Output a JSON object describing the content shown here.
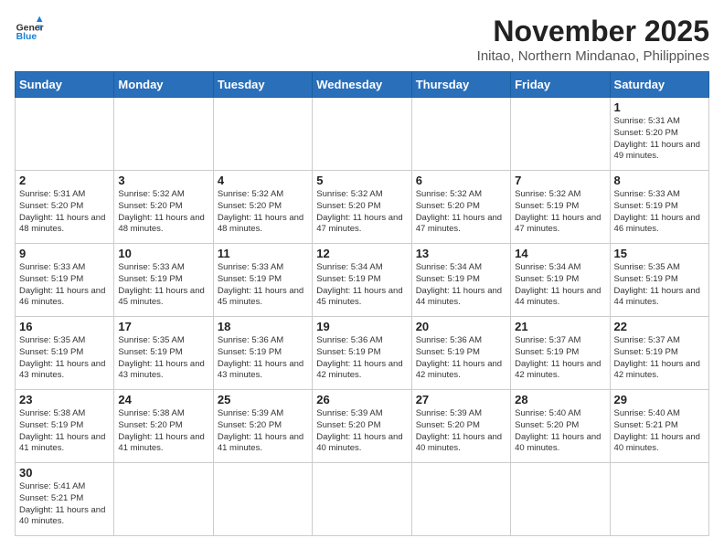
{
  "header": {
    "logo_general": "General",
    "logo_blue": "Blue",
    "month_title": "November 2025",
    "location": "Initao, Northern Mindanao, Philippines"
  },
  "days_of_week": [
    "Sunday",
    "Monday",
    "Tuesday",
    "Wednesday",
    "Thursday",
    "Friday",
    "Saturday"
  ],
  "weeks": [
    [
      {
        "day": "",
        "sunrise": "",
        "sunset": "",
        "daylight": ""
      },
      {
        "day": "",
        "sunrise": "",
        "sunset": "",
        "daylight": ""
      },
      {
        "day": "",
        "sunrise": "",
        "sunset": "",
        "daylight": ""
      },
      {
        "day": "",
        "sunrise": "",
        "sunset": "",
        "daylight": ""
      },
      {
        "day": "",
        "sunrise": "",
        "sunset": "",
        "daylight": ""
      },
      {
        "day": "",
        "sunrise": "",
        "sunset": "",
        "daylight": ""
      },
      {
        "day": "1",
        "sunrise": "Sunrise: 5:31 AM",
        "sunset": "Sunset: 5:20 PM",
        "daylight": "Daylight: 11 hours and 49 minutes."
      }
    ],
    [
      {
        "day": "2",
        "sunrise": "Sunrise: 5:31 AM",
        "sunset": "Sunset: 5:20 PM",
        "daylight": "Daylight: 11 hours and 48 minutes."
      },
      {
        "day": "3",
        "sunrise": "Sunrise: 5:32 AM",
        "sunset": "Sunset: 5:20 PM",
        "daylight": "Daylight: 11 hours and 48 minutes."
      },
      {
        "day": "4",
        "sunrise": "Sunrise: 5:32 AM",
        "sunset": "Sunset: 5:20 PM",
        "daylight": "Daylight: 11 hours and 48 minutes."
      },
      {
        "day": "5",
        "sunrise": "Sunrise: 5:32 AM",
        "sunset": "Sunset: 5:20 PM",
        "daylight": "Daylight: 11 hours and 47 minutes."
      },
      {
        "day": "6",
        "sunrise": "Sunrise: 5:32 AM",
        "sunset": "Sunset: 5:20 PM",
        "daylight": "Daylight: 11 hours and 47 minutes."
      },
      {
        "day": "7",
        "sunrise": "Sunrise: 5:32 AM",
        "sunset": "Sunset: 5:19 PM",
        "daylight": "Daylight: 11 hours and 47 minutes."
      },
      {
        "day": "8",
        "sunrise": "Sunrise: 5:33 AM",
        "sunset": "Sunset: 5:19 PM",
        "daylight": "Daylight: 11 hours and 46 minutes."
      }
    ],
    [
      {
        "day": "9",
        "sunrise": "Sunrise: 5:33 AM",
        "sunset": "Sunset: 5:19 PM",
        "daylight": "Daylight: 11 hours and 46 minutes."
      },
      {
        "day": "10",
        "sunrise": "Sunrise: 5:33 AM",
        "sunset": "Sunset: 5:19 PM",
        "daylight": "Daylight: 11 hours and 45 minutes."
      },
      {
        "day": "11",
        "sunrise": "Sunrise: 5:33 AM",
        "sunset": "Sunset: 5:19 PM",
        "daylight": "Daylight: 11 hours and 45 minutes."
      },
      {
        "day": "12",
        "sunrise": "Sunrise: 5:34 AM",
        "sunset": "Sunset: 5:19 PM",
        "daylight": "Daylight: 11 hours and 45 minutes."
      },
      {
        "day": "13",
        "sunrise": "Sunrise: 5:34 AM",
        "sunset": "Sunset: 5:19 PM",
        "daylight": "Daylight: 11 hours and 44 minutes."
      },
      {
        "day": "14",
        "sunrise": "Sunrise: 5:34 AM",
        "sunset": "Sunset: 5:19 PM",
        "daylight": "Daylight: 11 hours and 44 minutes."
      },
      {
        "day": "15",
        "sunrise": "Sunrise: 5:35 AM",
        "sunset": "Sunset: 5:19 PM",
        "daylight": "Daylight: 11 hours and 44 minutes."
      }
    ],
    [
      {
        "day": "16",
        "sunrise": "Sunrise: 5:35 AM",
        "sunset": "Sunset: 5:19 PM",
        "daylight": "Daylight: 11 hours and 43 minutes."
      },
      {
        "day": "17",
        "sunrise": "Sunrise: 5:35 AM",
        "sunset": "Sunset: 5:19 PM",
        "daylight": "Daylight: 11 hours and 43 minutes."
      },
      {
        "day": "18",
        "sunrise": "Sunrise: 5:36 AM",
        "sunset": "Sunset: 5:19 PM",
        "daylight": "Daylight: 11 hours and 43 minutes."
      },
      {
        "day": "19",
        "sunrise": "Sunrise: 5:36 AM",
        "sunset": "Sunset: 5:19 PM",
        "daylight": "Daylight: 11 hours and 42 minutes."
      },
      {
        "day": "20",
        "sunrise": "Sunrise: 5:36 AM",
        "sunset": "Sunset: 5:19 PM",
        "daylight": "Daylight: 11 hours and 42 minutes."
      },
      {
        "day": "21",
        "sunrise": "Sunrise: 5:37 AM",
        "sunset": "Sunset: 5:19 PM",
        "daylight": "Daylight: 11 hours and 42 minutes."
      },
      {
        "day": "22",
        "sunrise": "Sunrise: 5:37 AM",
        "sunset": "Sunset: 5:19 PM",
        "daylight": "Daylight: 11 hours and 42 minutes."
      }
    ],
    [
      {
        "day": "23",
        "sunrise": "Sunrise: 5:38 AM",
        "sunset": "Sunset: 5:19 PM",
        "daylight": "Daylight: 11 hours and 41 minutes."
      },
      {
        "day": "24",
        "sunrise": "Sunrise: 5:38 AM",
        "sunset": "Sunset: 5:20 PM",
        "daylight": "Daylight: 11 hours and 41 minutes."
      },
      {
        "day": "25",
        "sunrise": "Sunrise: 5:39 AM",
        "sunset": "Sunset: 5:20 PM",
        "daylight": "Daylight: 11 hours and 41 minutes."
      },
      {
        "day": "26",
        "sunrise": "Sunrise: 5:39 AM",
        "sunset": "Sunset: 5:20 PM",
        "daylight": "Daylight: 11 hours and 40 minutes."
      },
      {
        "day": "27",
        "sunrise": "Sunrise: 5:39 AM",
        "sunset": "Sunset: 5:20 PM",
        "daylight": "Daylight: 11 hours and 40 minutes."
      },
      {
        "day": "28",
        "sunrise": "Sunrise: 5:40 AM",
        "sunset": "Sunset: 5:20 PM",
        "daylight": "Daylight: 11 hours and 40 minutes."
      },
      {
        "day": "29",
        "sunrise": "Sunrise: 5:40 AM",
        "sunset": "Sunset: 5:21 PM",
        "daylight": "Daylight: 11 hours and 40 minutes."
      }
    ],
    [
      {
        "day": "30",
        "sunrise": "Sunrise: 5:41 AM",
        "sunset": "Sunset: 5:21 PM",
        "daylight": "Daylight: 11 hours and 40 minutes."
      },
      {
        "day": "",
        "sunrise": "",
        "sunset": "",
        "daylight": ""
      },
      {
        "day": "",
        "sunrise": "",
        "sunset": "",
        "daylight": ""
      },
      {
        "day": "",
        "sunrise": "",
        "sunset": "",
        "daylight": ""
      },
      {
        "day": "",
        "sunrise": "",
        "sunset": "",
        "daylight": ""
      },
      {
        "day": "",
        "sunrise": "",
        "sunset": "",
        "daylight": ""
      },
      {
        "day": "",
        "sunrise": "",
        "sunset": "",
        "daylight": ""
      }
    ]
  ]
}
